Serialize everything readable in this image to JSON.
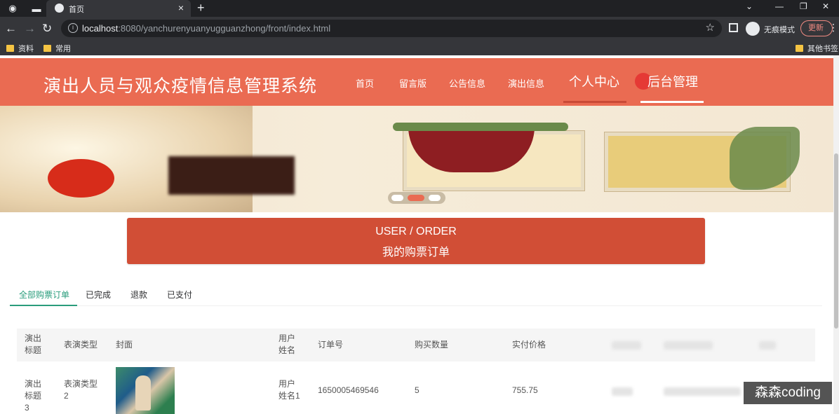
{
  "browser": {
    "tab_title": "首页",
    "url_host": "localhost",
    "url_rest": ":8080/yanchurenyuanyugguanzhong/front/index.html",
    "incognito_label": "无痕模式",
    "update_label": "更新",
    "bookmarks": [
      "资料",
      "常用"
    ],
    "other_bookmarks": "其他书签"
  },
  "site": {
    "title": "演出人员与观众疫情信息管理系统",
    "menu": [
      "首页",
      "留言版",
      "公告信息",
      "演出信息",
      "个人中心",
      "后台管理"
    ],
    "accent_color": "#ea6b52"
  },
  "order_banner": {
    "line1": "USER / ORDER",
    "line2": "我的购票订单"
  },
  "tabs": [
    "全部购票订单",
    "已完成",
    "退款",
    "已支付"
  ],
  "table": {
    "headers": [
      "演出标题",
      "表演类型",
      "封面",
      "用户姓名",
      "订单号",
      "购买数量",
      "实付价格"
    ],
    "rows": [
      {
        "title": "演出标题3",
        "type": "表演类型2",
        "user": "用户姓名1",
        "order_no": "1650005469546",
        "quantity": "5",
        "price": "755.75"
      }
    ]
  },
  "watermark": "森森coding"
}
